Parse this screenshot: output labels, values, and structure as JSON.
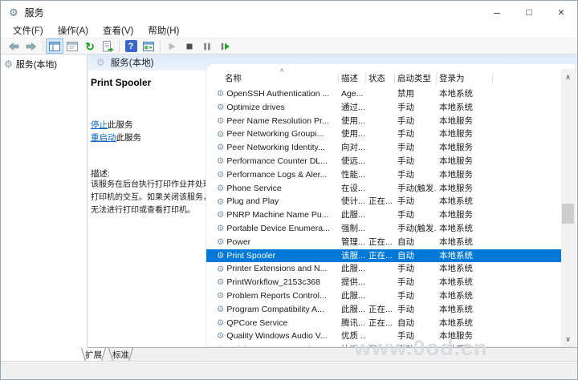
{
  "titlebar": {
    "title": "服务"
  },
  "menubar": {
    "items": [
      "文件(F)",
      "操作(A)",
      "查看(V)",
      "帮助(H)"
    ]
  },
  "toolbar": {
    "buttons": [
      "back",
      "forward",
      "show-console-tree",
      "properties",
      "refresh",
      "export-list",
      "help",
      "extended-view",
      "start-service",
      "stop-service",
      "pause-service",
      "restart-service"
    ]
  },
  "tree": {
    "root_label": "服务(本地)"
  },
  "content_header": {
    "label": "服务(本地)"
  },
  "info_panel": {
    "service_title": "Print Spooler",
    "stop_link_text": "停止",
    "stop_rest_text": "此服务",
    "restart_link_text": "重启动",
    "restart_rest_text": "此服务",
    "description_label": "描述:",
    "description": "该服务在后台执行打印作业并处理与打印机的交互。如果关闭该服务，则无法进行打印或查看打印机。"
  },
  "table": {
    "columns": [
      "名称",
      "描述",
      "状态",
      "启动类型",
      "登录为"
    ],
    "selected_service": "Print Spooler",
    "rows": [
      {
        "name": "OpenSSH Authentication ...",
        "desc": "Age...",
        "status": "",
        "startup": "禁用",
        "logon": "本地系统",
        "selected": false
      },
      {
        "name": "Optimize drives",
        "desc": "通过...",
        "status": "",
        "startup": "手动",
        "logon": "本地系统",
        "selected": false
      },
      {
        "name": "Peer Name Resolution Pr...",
        "desc": "使用...",
        "status": "",
        "startup": "手动",
        "logon": "本地服务",
        "selected": false
      },
      {
        "name": "Peer Networking Groupi...",
        "desc": "使用...",
        "status": "",
        "startup": "手动",
        "logon": "本地服务",
        "selected": false
      },
      {
        "name": "Peer Networking Identity...",
        "desc": "向对...",
        "status": "",
        "startup": "手动",
        "logon": "本地服务",
        "selected": false
      },
      {
        "name": "Performance Counter DL...",
        "desc": "使远...",
        "status": "",
        "startup": "手动",
        "logon": "本地服务",
        "selected": false
      },
      {
        "name": "Performance Logs & Aler...",
        "desc": "性能...",
        "status": "",
        "startup": "手动",
        "logon": "本地服务",
        "selected": false
      },
      {
        "name": "Phone Service",
        "desc": "在设...",
        "status": "",
        "startup": "手动(触发...",
        "logon": "本地服务",
        "selected": false
      },
      {
        "name": "Plug and Play",
        "desc": "使计...",
        "status": "正在...",
        "startup": "手动",
        "logon": "本地系统",
        "selected": false
      },
      {
        "name": "PNRP Machine Name Pu...",
        "desc": "此服...",
        "status": "",
        "startup": "手动",
        "logon": "本地服务",
        "selected": false
      },
      {
        "name": "Portable Device Enumera...",
        "desc": "强制...",
        "status": "",
        "startup": "手动(触发...",
        "logon": "本地系统",
        "selected": false
      },
      {
        "name": "Power",
        "desc": "管理...",
        "status": "正在...",
        "startup": "自动",
        "logon": "本地系统",
        "selected": false
      },
      {
        "name": "Print Spooler",
        "desc": "该服...",
        "status": "正在...",
        "startup": "自动",
        "logon": "本地系统",
        "selected": true
      },
      {
        "name": "Printer Extensions and N...",
        "desc": "此服...",
        "status": "",
        "startup": "手动",
        "logon": "本地系统",
        "selected": false
      },
      {
        "name": "PrintWorkflow_2153c368",
        "desc": "提供...",
        "status": "",
        "startup": "手动",
        "logon": "本地系统",
        "selected": false
      },
      {
        "name": "Problem Reports Control...",
        "desc": "此服...",
        "status": "",
        "startup": "手动",
        "logon": "本地系统",
        "selected": false
      },
      {
        "name": "Program Compatibility A...",
        "desc": "此服...",
        "status": "正在...",
        "startup": "手动",
        "logon": "本地系统",
        "selected": false
      },
      {
        "name": "QPCore Service",
        "desc": "腾讯...",
        "status": "正在...",
        "startup": "自动",
        "logon": "本地系统",
        "selected": false
      },
      {
        "name": "Quality Windows Audio V...",
        "desc": "优质 ...",
        "status": "",
        "startup": "手动",
        "logon": "本地服务",
        "selected": false
      },
      {
        "name": "Quick See Images Helpe...",
        "desc": "快速...",
        "status": "正在...",
        "startup": "自动",
        "logon": "本地系统",
        "selected": false
      }
    ]
  },
  "tabs": {
    "items": [
      "扩展",
      "标准"
    ],
    "active": "扩展"
  },
  "watermark": "www.0od.cn",
  "icons": {
    "app_gear": "⚙",
    "tree_gear": "⚙",
    "header_gear": "⚙",
    "row_gear": "⚙",
    "minimize": "–",
    "maximize": "□",
    "close": "×",
    "refresh": "↻",
    "help": "?",
    "sort_asc": "^",
    "scroll_up": "∧",
    "scroll_down": "∨"
  },
  "colors": {
    "selection_bg": "#0078d7",
    "selection_text": "#ffffff",
    "link": "#0563c1",
    "row_icon": "#7d93a8"
  }
}
